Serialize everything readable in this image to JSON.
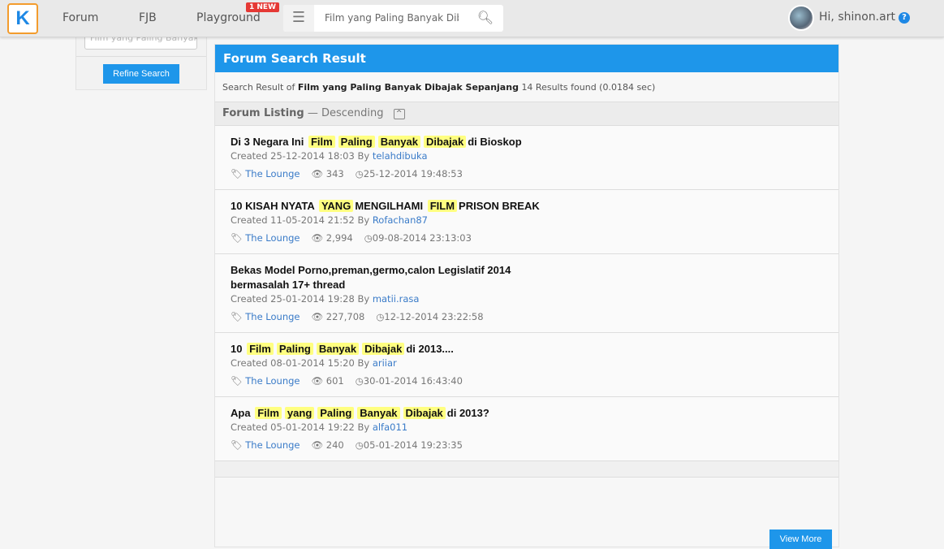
{
  "header": {
    "logo": "K",
    "nav": [
      "Forum",
      "FJB",
      "Playground"
    ],
    "badge": "1 NEW",
    "search_value": "Film yang Paling Banyak Dibajak Sepanjang",
    "user_greeting": "Hi, shinon.art"
  },
  "sidebar": {
    "search_value": "Film yang Paling Banyak Dibajak Sepanjang",
    "refine_label": "Refine Search"
  },
  "main": {
    "title": "Forum Search Result",
    "summary": {
      "prefix": "Search Result of",
      "query": "Film yang Paling Banyak Dibajak Sepanjang",
      "count": "14 Results found (0.0184 sec)"
    },
    "listing": {
      "label": "Forum Listing",
      "order": "— Descending"
    },
    "items": [
      {
        "title": [
          [
            "Di 3 Negara Ini",
            0
          ],
          [
            "Film",
            1
          ],
          [
            "Paling",
            1
          ],
          [
            "Banyak",
            1
          ],
          [
            "Dibajak",
            1
          ],
          [
            "di Bioskop",
            0
          ]
        ],
        "created": "Created 25-12-2014 18:03 By",
        "author": "telahdibuka",
        "forum": "The Lounge",
        "views": "343",
        "last": "25-12-2014 19:48:53"
      },
      {
        "title": [
          [
            "10 KISAH NYATA",
            0
          ],
          [
            "YANG",
            1
          ],
          [
            "MENGILHAMI",
            0
          ],
          [
            "FILM",
            1
          ],
          [
            "PRISON BREAK",
            0
          ]
        ],
        "created": "Created 11-05-2014 21:52 By",
        "author": "Rofachan87",
        "forum": "The Lounge",
        "views": "2,994",
        "last": "09-08-2014 23:13:03"
      },
      {
        "title": [
          [
            "Bekas Model Porno,preman,germo,calon Legislatif 2014 bermasalah 17+ thread",
            0
          ]
        ],
        "created": "Created 25-01-2014 19:28 By",
        "author": "matii.rasa",
        "forum": "The Lounge",
        "views": "227,708",
        "last": "12-12-2014 23:22:58"
      },
      {
        "title": [
          [
            "10",
            0
          ],
          [
            "Film",
            1
          ],
          [
            "Paling",
            1
          ],
          [
            "Banyak",
            1
          ],
          [
            "Dibajak",
            1
          ],
          [
            "di 2013....",
            0
          ]
        ],
        "created": "Created 08-01-2014 15:20 By",
        "author": "ariiar",
        "forum": "The Lounge",
        "views": "601",
        "last": "30-01-2014 16:43:40"
      },
      {
        "title": [
          [
            "Apa",
            0
          ],
          [
            "Film",
            1
          ],
          [
            "yang",
            1
          ],
          [
            "Paling",
            1
          ],
          [
            "Banyak",
            1
          ],
          [
            "Dibajak",
            1
          ],
          [
            "di 2013?",
            0
          ]
        ],
        "created": "Created 05-01-2014 19:22 By",
        "author": "alfa011",
        "forum": "The Lounge",
        "views": "240",
        "last": "05-01-2014 19:23:35"
      }
    ],
    "view_more": "View More"
  },
  "colors": {
    "accent": "#1e96ea",
    "highlight": "#ffff80",
    "badge": "#e53935",
    "logo_border": "#f39c2d"
  }
}
